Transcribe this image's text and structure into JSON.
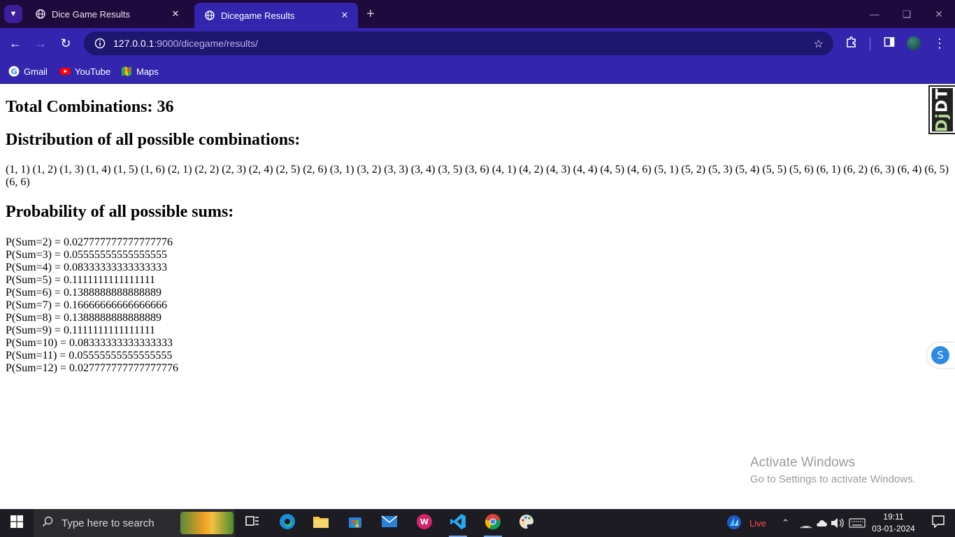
{
  "browser": {
    "tabs": [
      {
        "title": "Dice Game Results",
        "active": false
      },
      {
        "title": "Dicegame Results",
        "active": true
      }
    ],
    "url_host": "127.0.0.1",
    "url_path": ":9000/dicegame/results/",
    "bookmarks": [
      "Gmail",
      "YouTube",
      "Maps"
    ],
    "theme_color": "#3425ae"
  },
  "page": {
    "total_heading": "Total Combinations: 36",
    "distribution_heading": "Distribution of all possible combinations:",
    "combinations": "(1, 1) (1, 2) (1, 3) (1, 4) (1, 5) (1, 6) (2, 1) (2, 2) (2, 3) (2, 4) (2, 5) (2, 6) (3, 1) (3, 2) (3, 3) (3, 4) (3, 5) (3, 6) (4, 1) (4, 2) (4, 3) (4, 4) (4, 5) (4, 6) (5, 1) (5, 2) (5, 3) (5, 4) (5, 5) (5, 6) (6, 1) (6, 2) (6, 3) (6, 4) (6, 5) (6, 6)",
    "probability_heading": "Probability of all possible sums:",
    "probabilities": [
      "P(Sum=2) = 0.027777777777777776",
      "P(Sum=3) = 0.05555555555555555",
      "P(Sum=4) = 0.08333333333333333",
      "P(Sum=5) = 0.1111111111111111",
      "P(Sum=6) = 0.1388888888888889",
      "P(Sum=7) = 0.16666666666666666",
      "P(Sum=8) = 0.1388888888888889",
      "P(Sum=9) = 0.1111111111111111",
      "P(Sum=10) = 0.08333333333333333",
      "P(Sum=11) = 0.05555555555555555",
      "P(Sum=12) = 0.027777777777777776"
    ],
    "djdt_label_dj": "Dj",
    "djdt_label_dt": "DT",
    "float_button": "S"
  },
  "watermark": {
    "line1": "Activate Windows",
    "line2": "Go to Settings to activate Windows."
  },
  "taskbar": {
    "search_placeholder": "Type here to search",
    "live_label": "Live",
    "time": "19:11",
    "date": "03-01-2024"
  }
}
